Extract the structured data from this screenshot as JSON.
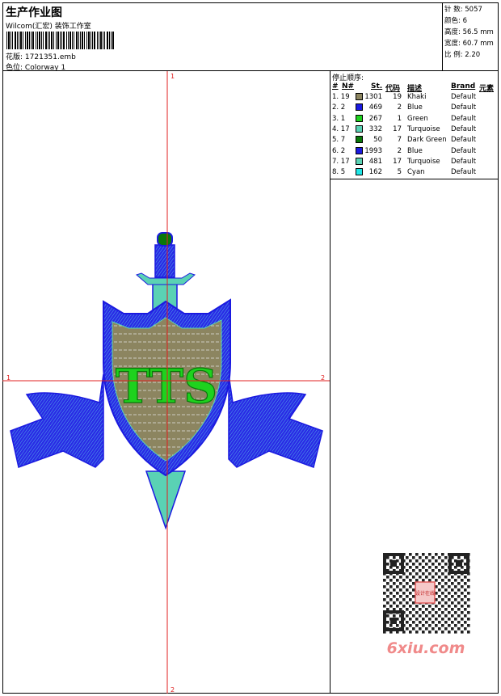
{
  "header": {
    "title": "生产作业图",
    "company": "Wilcom(汇宏) 装饰工作室",
    "design_file_label": "花版:",
    "design_file": "1721351.emb",
    "colorway_label": "色位:",
    "colorway": "Colorway 1"
  },
  "stats": {
    "stitches": "针 数: 5057",
    "colors": "颜色: 6",
    "height": "高度: 56.5 mm",
    "width": "宽度: 60.7 mm",
    "ratio": "比 例: 2.20"
  },
  "stop_sequence": {
    "title": "停止顺序:",
    "headers": {
      "num": "#",
      "n": "N#",
      "st": "St.",
      "code": "代码",
      "desc": "描述",
      "brand": "Brand",
      "elem": "元素"
    },
    "rows": [
      {
        "num": "1. 19",
        "st": "1301",
        "code": "19",
        "desc": "Khaki",
        "brand": "Default",
        "color": "#8c8560"
      },
      {
        "num": "2. 2",
        "st": "469",
        "code": "2",
        "desc": "Blue",
        "brand": "Default",
        "color": "#1a1ae0"
      },
      {
        "num": "3. 1",
        "st": "267",
        "code": "1",
        "desc": "Green",
        "brand": "Default",
        "color": "#1ed21e"
      },
      {
        "num": "4. 17",
        "st": "332",
        "code": "17",
        "desc": "Turquoise",
        "brand": "Default",
        "color": "#5ad2b4"
      },
      {
        "num": "5. 7",
        "st": "50",
        "code": "7",
        "desc": "Dark Green",
        "brand": "Default",
        "color": "#0a780a"
      },
      {
        "num": "6. 2",
        "st": "1993",
        "code": "2",
        "desc": "Blue",
        "brand": "Default",
        "color": "#1a1ae0"
      },
      {
        "num": "7. 17",
        "st": "481",
        "code": "17",
        "desc": "Turquoise",
        "brand": "Default",
        "color": "#5ad2b4"
      },
      {
        "num": "8. 5",
        "st": "162",
        "code": "5",
        "desc": "Cyan",
        "brand": "Default",
        "color": "#1ee6e6"
      }
    ]
  },
  "axis_markers": {
    "top": "1",
    "bottom": "2",
    "left": "1",
    "right": "2"
  },
  "design": {
    "letters": "TTS"
  },
  "watermark": {
    "text": "6xiu.com",
    "stamp": "设计在线"
  },
  "colors": {
    "crosshair": "#e02020",
    "blue": "#1a1ae0",
    "turquoise": "#5ad2b4",
    "khaki": "#8c8560",
    "green": "#1ed21e"
  }
}
